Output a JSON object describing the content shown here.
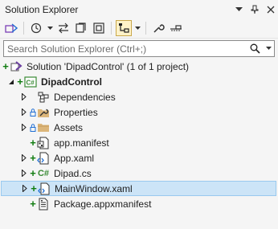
{
  "panel": {
    "title": "Solution Explorer"
  },
  "search": {
    "placeholder": "Search Solution Explorer (Ctrl+;)"
  },
  "tree": {
    "solution": "Solution 'DipadControl' (1 of 1 project)",
    "project": "DipadControl",
    "items": [
      {
        "label": "Dependencies"
      },
      {
        "label": "Properties"
      },
      {
        "label": "Assets"
      },
      {
        "label": "app.manifest"
      },
      {
        "label": "App.xaml"
      },
      {
        "label": "Dipad.cs"
      },
      {
        "label": "MainWindow.xaml",
        "selected": true
      },
      {
        "label": "Package.appxmanifest"
      }
    ],
    "cs_badge": "C#"
  },
  "colors": {
    "selection": "#cce4f7",
    "added": "#107c10",
    "folder": "#dcb67a",
    "cs": "#388a34"
  }
}
